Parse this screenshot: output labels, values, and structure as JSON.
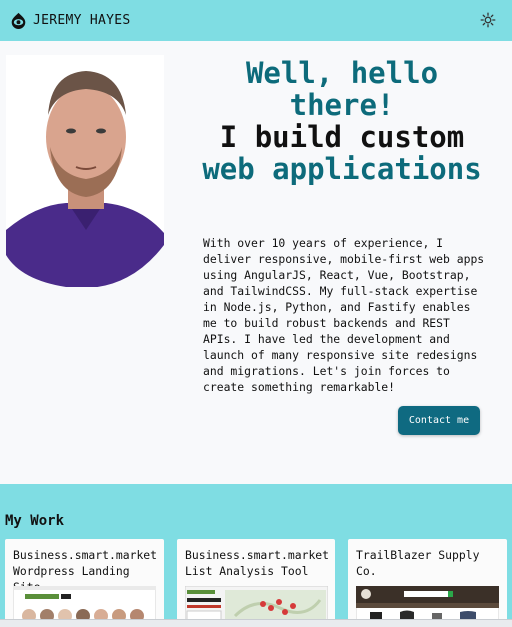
{
  "header": {
    "brand_name": "JEREMY HAYES",
    "logo_icon": "eye-logo-icon",
    "theme_toggle_icon": "sun-icon"
  },
  "hero": {
    "headline_line1": "Well, hello there!",
    "headline_line2": "I build custom",
    "headline_line3": "web applications",
    "intro": "With over 10 years of experience, I deliver responsive, mobile-first web apps using AngularJS, React, Vue, Bootstrap, and TailwindCSS. My full-stack expertise in Node.js, Python, and Fastify enables me to build robust backends and REST APIs. I have led the development and launch of many responsive site redesigns and migrations. Let's join forces to create something remarkable!",
    "contact_label": "Contact me"
  },
  "work": {
    "title": "My Work",
    "cards": [
      {
        "title": "Business.smart.market Wordpress Landing Site"
      },
      {
        "title": "Business.smart.market List Analysis Tool"
      },
      {
        "title": "TrailBlazer Supply Co."
      }
    ]
  },
  "colors": {
    "accent_bar": "#7fdde3",
    "teal_text": "#0d6b7b",
    "button": "#0f6a81",
    "background": "#f8f9fb"
  }
}
